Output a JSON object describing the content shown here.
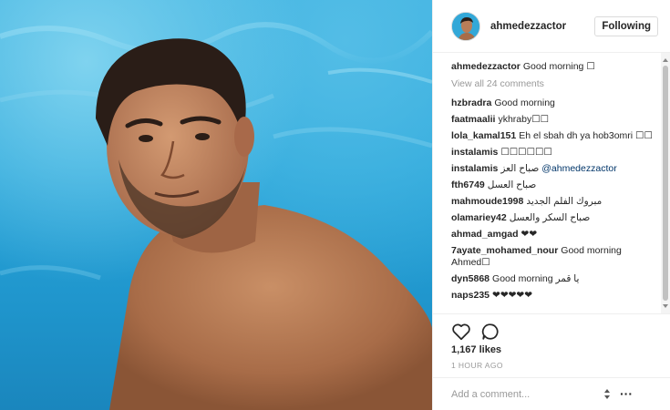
{
  "post": {
    "username": "ahmedezzactor",
    "follow_label": "Following",
    "caption": {
      "user": "ahmedezzactor",
      "text": "Good morning ☐"
    },
    "view_all_label": "View all 24 comments",
    "comments": [
      {
        "user": "hzbradra",
        "text": "Good morning"
      },
      {
        "user": "faatmaalii",
        "text": "ykhraby☐☐"
      },
      {
        "user": "lola_kamal151",
        "text": "Eh el sbah dh ya hob3omri ☐☐"
      },
      {
        "user": "instalamis",
        "text": "☐☐☐☐☐☐"
      },
      {
        "user": "instalamis",
        "text": "صباح العز",
        "mention": "@ahmedezzactor"
      },
      {
        "user": "fth6749",
        "text": "صباح العسل"
      },
      {
        "user": "mahmoude1998",
        "text": "مبروك الفلم الجديد"
      },
      {
        "user": "olamariey42",
        "text": "صباح السكر والعسل"
      },
      {
        "user": "ahmad_amgad",
        "text": "❤❤"
      },
      {
        "user": "7ayate_mohamed_nour",
        "text": "Good morning Ahmed☐"
      },
      {
        "user": "dyn5868",
        "text": "Good morning يا قمر"
      },
      {
        "user": "naps235",
        "text": "❤❤❤❤❤"
      }
    ],
    "likes_label": "1,167 likes",
    "time_label": "1 HOUR AGO",
    "add_comment_placeholder": "Add a comment...",
    "more_label": "···"
  },
  "icons": {
    "like": "heart-outline-icon",
    "comment": "speech-bubble-icon",
    "more": "ellipsis-icon"
  },
  "colors": {
    "water": "#2aa6da",
    "text": "#262626",
    "muted": "#999999",
    "mention": "#003569",
    "border": "#efefef"
  }
}
